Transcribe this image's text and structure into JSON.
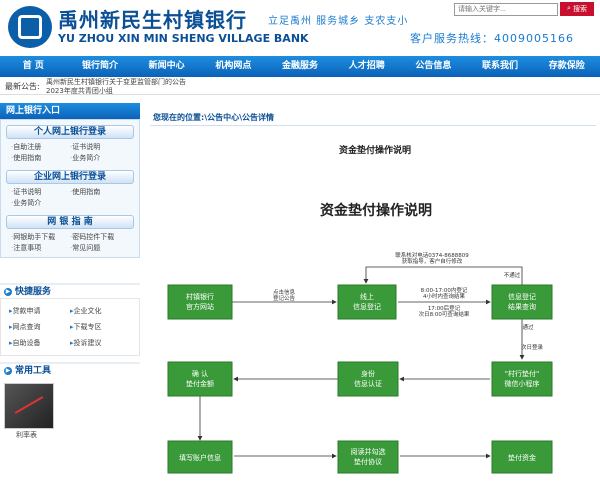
{
  "header": {
    "bank_name_cn": "禹州新民生村镇银行",
    "bank_name_en": "YU ZHOU XIN MIN SHENG VILLAGE BANK",
    "slogan": "立足禹州  服务城乡  支农支小",
    "hotline": "客户服务热线：4009005166",
    "search_placeholder": "请输入关键字...",
    "search_button": "搜索",
    "logo_icon": "bank-logo-icon",
    "accent_color": "#0b4f95"
  },
  "nav": [
    "首 页",
    "银行简介",
    "新闻中心",
    "机构网点",
    "金融服务",
    "人才招聘",
    "公告信息",
    "联系我们",
    "存款保险"
  ],
  "notice": {
    "label": "最新公告:",
    "line1": "禹州新民生村镇银行关于变更监管部门的公告",
    "line2": "2023年度共青团小组"
  },
  "sidebar": {
    "header": "网上银行入口",
    "personal": {
      "title": "个人网上银行登录",
      "links": [
        "自助注册",
        "证书说明",
        "使用指南",
        "业务简介"
      ]
    },
    "corporate": {
      "title": "企业网上银行登录",
      "links": [
        "证书说明",
        "使用指南",
        "业务简介"
      ]
    },
    "guide": {
      "title": "网 银 指 南",
      "links": [
        "网银助手下载",
        "密码控件下载",
        "注意事项",
        "常见问题"
      ]
    },
    "quick": {
      "title": "快捷服务",
      "links": [
        "贷款申请",
        "企业文化",
        "网点查询",
        "下载专区",
        "自助设备",
        "投诉建议"
      ]
    },
    "tools": {
      "title": "常用工具",
      "caption": "利率表"
    }
  },
  "main": {
    "breadcrumb": "您现在的位置:\\公告中心\\公告详情",
    "article_title": "资金垫付操作说明",
    "flow": {
      "title": "资金垫付操作说明",
      "nodes": {
        "n1": [
          "村镇银行",
          "官方网站"
        ],
        "n2": [
          "线上",
          "信息登记"
        ],
        "n3": [
          "信息登记",
          "结果查询"
        ],
        "n4": [
          "\"村行垫付\"",
          "微信小程序"
        ],
        "n5": [
          "身份",
          "信息认证"
        ],
        "n6": [
          "确 认",
          "垫付金额"
        ],
        "n7": [
          "填写账户信息"
        ],
        "n8": [
          "阅读并勾选",
          "垫付协议"
        ],
        "n9": [
          "垫付资金"
        ]
      },
      "labels": {
        "e1a": "点击信息",
        "e1b": "登记公告",
        "e2a": "8:00-17:00内登记",
        "e2b": "4小时内查询结果",
        "e2c": "17:00后登记",
        "e2d": "次日8:00可查询结果",
        "top1": "联系核对电话0374-8688809",
        "top2": "获取指导，客户自行修改",
        "fail": "不通过",
        "pass": "通过",
        "next": "次日登录"
      }
    }
  }
}
